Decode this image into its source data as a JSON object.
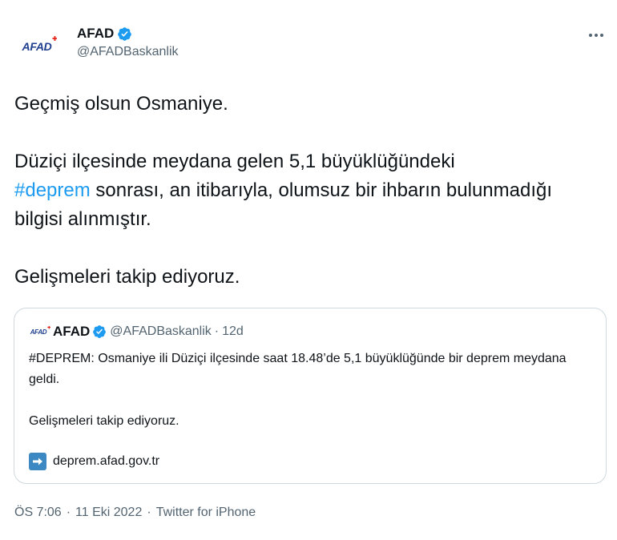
{
  "author": {
    "avatar_text": "AFAD",
    "display_name": "AFAD",
    "handle": "@AFADBaskanlik",
    "verified": true,
    "badge_color": "#1d9bf0"
  },
  "tweet": {
    "line1": "Geçmiş olsun Osmaniye.",
    "para2_before": "Düziçi ilçesinde meydana gelen 5,1 büyüklüğündeki",
    "hashtag": "#deprem",
    "para2_after": " sonrası, an itibarıyla, olumsuz bir ihbarın bulunmadığı bilgisi alınmıştır.",
    "line3": "Gelişmeleri takip ediyoruz."
  },
  "quote": {
    "avatar_text": "AFAD",
    "display_name": "AFAD",
    "handle": "@AFADBaskanlik",
    "separator": "·",
    "age": "12d",
    "text1": "#DEPREM: Osmaniye ili Düziçi ilçesinde saat 18.48’de 5,1 büyüklüğünde bir deprem meydana geldi.",
    "text2": "Gelişmeleri takip ediyoruz.",
    "link_icon": "right-arrow-icon",
    "link": "deprem.afad.gov.tr"
  },
  "meta": {
    "time": "ÖS 7:06",
    "sep1": "·",
    "date": "11 Eki 2022",
    "sep2": "·",
    "source": "Twitter for iPhone"
  },
  "icons": {
    "more": "more-horizontal-icon",
    "verified": "verified-badge-icon"
  },
  "colors": {
    "hashtag": "#1d9bf0",
    "secondary_text": "#536471",
    "brand_blue": "#1f3f8f",
    "brand_red": "#e1251b"
  }
}
